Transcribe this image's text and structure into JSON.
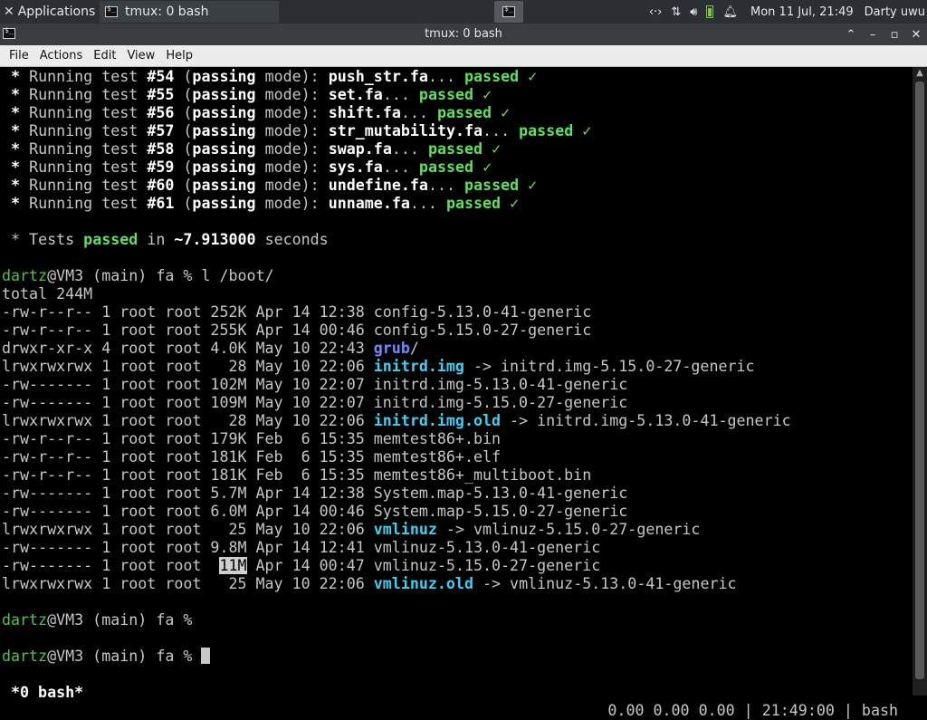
{
  "panel": {
    "apps_label": "Applications",
    "task_label": "tmux: 0 bash",
    "tray": {
      "datetime": "Mon 11 Jul, 21:49",
      "user": "Darty uwu"
    }
  },
  "window": {
    "title": "tmux: 0 bash"
  },
  "menu": [
    "File",
    "Actions",
    "Edit",
    "View",
    "Help"
  ],
  "tests": [
    {
      "prefix": " * ",
      "t1": "Running test ",
      "num": "#54",
      "mode_open": " (",
      "mode_bold": "passing",
      "mode_rest": " mode): ",
      "file": "push_str.fa",
      "dots": "... ",
      "result": "passed",
      "check": " ✓"
    },
    {
      "prefix": " * ",
      "t1": "Running test ",
      "num": "#55",
      "mode_open": " (",
      "mode_bold": "passing",
      "mode_rest": " mode): ",
      "file": "set.fa",
      "dots": "... ",
      "result": "passed",
      "check": " ✓"
    },
    {
      "prefix": " * ",
      "t1": "Running test ",
      "num": "#56",
      "mode_open": " (",
      "mode_bold": "passing",
      "mode_rest": " mode): ",
      "file": "shift.fa",
      "dots": "... ",
      "result": "passed",
      "check": " ✓"
    },
    {
      "prefix": " * ",
      "t1": "Running test ",
      "num": "#57",
      "mode_open": " (",
      "mode_bold": "passing",
      "mode_rest": " mode): ",
      "file": "str_mutability.fa",
      "dots": "... ",
      "result": "passed",
      "check": " ✓"
    },
    {
      "prefix": " * ",
      "t1": "Running test ",
      "num": "#58",
      "mode_open": " (",
      "mode_bold": "passing",
      "mode_rest": " mode): ",
      "file": "swap.fa",
      "dots": "... ",
      "result": "passed",
      "check": " ✓"
    },
    {
      "prefix": " * ",
      "t1": "Running test ",
      "num": "#59",
      "mode_open": " (",
      "mode_bold": "passing",
      "mode_rest": " mode): ",
      "file": "sys.fa",
      "dots": "... ",
      "result": "passed",
      "check": " ✓"
    },
    {
      "prefix": " * ",
      "t1": "Running test ",
      "num": "#60",
      "mode_open": " (",
      "mode_bold": "passing",
      "mode_rest": " mode): ",
      "file": "undefine.fa",
      "dots": "... ",
      "result": "passed",
      "check": " ✓"
    },
    {
      "prefix": " * ",
      "t1": "Running test ",
      "num": "#61",
      "mode_open": " (",
      "mode_bold": "passing",
      "mode_rest": " mode): ",
      "file": "unname.fa",
      "dots": "... ",
      "result": "passed",
      "check": " ✓"
    }
  ],
  "summary": {
    "a": " * Tests ",
    "b": "passed",
    "c": " in ",
    "d": "~7.913000",
    "e": " seconds"
  },
  "prompt": {
    "user": "dartz",
    "host": "@VM3 (main) fa % "
  },
  "command": "l /boot/",
  "total": "total 244M",
  "listing": [
    {
      "perm": "-rw-r--r-- 1 root root 252K Apr 14 12:38 ",
      "name": "config-5.13.0-41-generic",
      "kind": "plain",
      "target": ""
    },
    {
      "perm": "-rw-r--r-- 1 root root 255K Apr 14 00:46 ",
      "name": "config-5.15.0-27-generic",
      "kind": "plain",
      "target": ""
    },
    {
      "perm": "drwxr-xr-x 4 root root 4.0K May 10 22:43 ",
      "name": "grub",
      "kind": "dir",
      "target": ""
    },
    {
      "perm": "lrwxrwxrwx 1 root root   28 May 10 22:06 ",
      "name": "initrd.img",
      "kind": "link",
      "target": " -> initrd.img-5.15.0-27-generic"
    },
    {
      "perm": "-rw------- 1 root root 102M May 10 22:07 ",
      "name": "initrd.img-5.13.0-41-generic",
      "kind": "plain",
      "target": ""
    },
    {
      "perm": "-rw------- 1 root root 109M May 10 22:07 ",
      "name": "initrd.img-5.15.0-27-generic",
      "kind": "plain",
      "target": ""
    },
    {
      "perm": "lrwxrwxrwx 1 root root   28 May 10 22:06 ",
      "name": "initrd.img.old",
      "kind": "link",
      "target": " -> initrd.img-5.13.0-41-generic"
    },
    {
      "perm": "-rw-r--r-- 1 root root 179K Feb  6 15:35 ",
      "name": "memtest86+.bin",
      "kind": "plain",
      "target": ""
    },
    {
      "perm": "-rw-r--r-- 1 root root 181K Feb  6 15:35 ",
      "name": "memtest86+.elf",
      "kind": "plain",
      "target": ""
    },
    {
      "perm": "-rw-r--r-- 1 root root 181K Feb  6 15:35 ",
      "name": "memtest86+_multiboot.bin",
      "kind": "plain",
      "target": ""
    },
    {
      "perm": "-rw------- 1 root root 5.7M Apr 14 12:38 ",
      "name": "System.map-5.13.0-41-generic",
      "kind": "plain",
      "target": ""
    },
    {
      "perm": "-rw------- 1 root root 6.0M Apr 14 00:46 ",
      "name": "System.map-5.15.0-27-generic",
      "kind": "plain",
      "target": ""
    },
    {
      "perm": "lrwxrwxrwx 1 root root   25 May 10 22:06 ",
      "name": "vmlinuz",
      "kind": "link",
      "target": " -> vmlinuz-5.15.0-27-generic"
    },
    {
      "perm": "-rw------- 1 root root 9.8M Apr 14 12:41 ",
      "name": "vmlinuz-5.13.0-41-generic",
      "kind": "plain",
      "target": ""
    },
    {
      "perm_a": "-rw------- 1 root root  ",
      "size_hl": "11M",
      "perm_b": " Apr 14 00:47 ",
      "name": "vmlinuz-5.15.0-27-generic",
      "kind": "plain",
      "target": ""
    },
    {
      "perm": "lrwxrwxrwx 1 root root   25 May 10 22:06 ",
      "name": "vmlinuz.old",
      "kind": "link",
      "target": " -> vmlinuz-5.13.0-41-generic"
    }
  ],
  "status": {
    "left": "*0 bash*",
    "right": "0.00 0.00 0.00 | 21:49:00 | bash"
  }
}
